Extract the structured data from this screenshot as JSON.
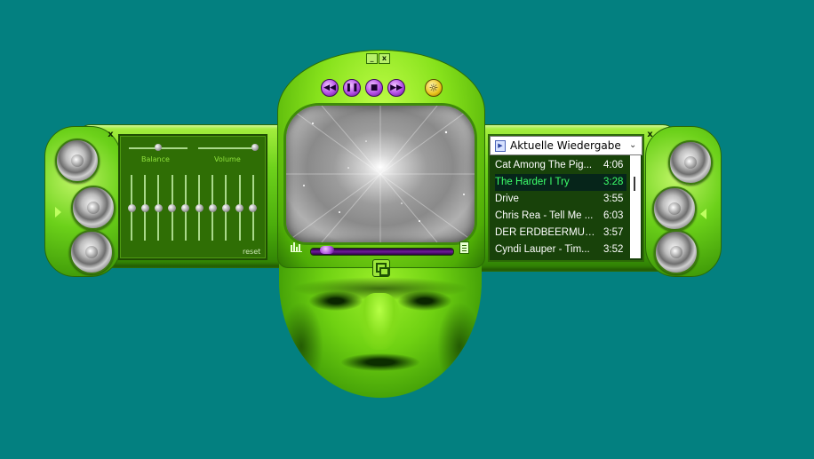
{
  "window": {
    "minimize_label": "_",
    "close_label": "x"
  },
  "equalizer": {
    "close_label": "x",
    "balance_label": "Balance",
    "volume_label": "Volume",
    "reset_label": "reset",
    "bands": [
      0.5,
      0.5,
      0.5,
      0.5,
      0.5,
      0.5,
      0.5,
      0.5,
      0.5,
      0.5
    ],
    "balance": 0.5,
    "volume": 1.0
  },
  "controls": {
    "prev_icon": "skip-back-icon",
    "pause_icon": "pause-icon",
    "stop_icon": "stop-icon",
    "next_icon": "skip-forward-icon",
    "options_icon": "sun-icon"
  },
  "seek": {
    "position": 0.05
  },
  "playlist": {
    "close_label": "x",
    "selected_list": "Aktuelle Wiedergabe",
    "items": [
      {
        "title": "Cat Among The Pig...",
        "duration": "4:06"
      },
      {
        "title": "The Harder I Try",
        "duration": "3:28"
      },
      {
        "title": "Drive",
        "duration": "3:55"
      },
      {
        "title": "Chris Rea -  Tell Me ...",
        "duration": "6:03"
      },
      {
        "title": "DER ERDBEERMUND",
        "duration": "3:57"
      },
      {
        "title": "Cyndi Lauper - Tim...",
        "duration": "3:52"
      }
    ],
    "selected_index": 1
  },
  "colors": {
    "desktop": "#038080",
    "skin_green": "#6ed21c",
    "control_purple": "#b450e6",
    "playlist_bg": "#18420a",
    "selected_text": "#3dff6a"
  }
}
